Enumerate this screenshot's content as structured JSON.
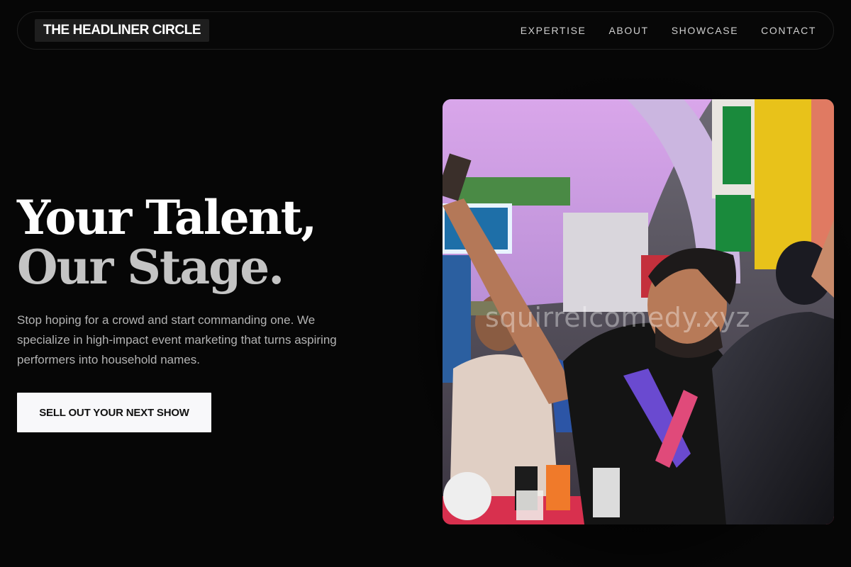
{
  "brand": {
    "name": "THE HEADLINER CIRCLE"
  },
  "nav": {
    "links": [
      "EXPERTISE",
      "ABOUT",
      "SHOWCASE",
      "CONTACT"
    ]
  },
  "hero": {
    "headline_line1": "Your Talent,",
    "headline_line2": "Our Stage.",
    "subcopy": "Stop hoping for a crowd and start commanding one. We specialize in high-impact event marketing that turns aspiring performers into household names.",
    "cta_label": "SELL OUT YOUR NEXT SHOW",
    "image_watermark": "squirrelcomedy.xyz"
  },
  "colors": {
    "background": "#060606",
    "headline_primary": "#ffffff",
    "headline_secondary": "#c4c4c4",
    "body_text": "#b3b3b3",
    "cta_background": "#f8f8fa"
  }
}
